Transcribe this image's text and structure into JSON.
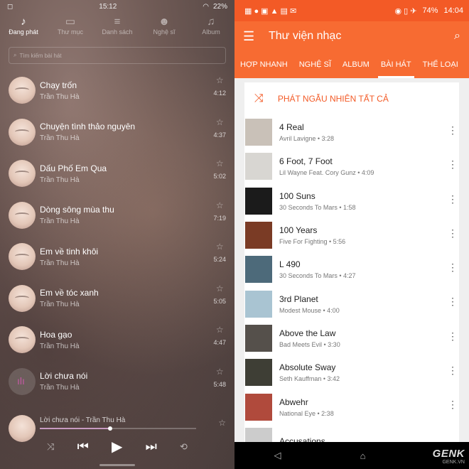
{
  "left": {
    "status": {
      "time": "15:12",
      "battery": "22%"
    },
    "tabs": [
      {
        "label": "Đang phát",
        "icon": "music-note-icon",
        "active": true
      },
      {
        "label": "Thư mục",
        "icon": "folder-icon",
        "active": false
      },
      {
        "label": "Danh sách",
        "icon": "playlist-icon",
        "active": false
      },
      {
        "label": "Nghệ sĩ",
        "icon": "artist-icon",
        "active": false
      },
      {
        "label": "Album",
        "icon": "album-icon",
        "active": false
      }
    ],
    "search_placeholder": "Tìm kiếm bài hát",
    "songs": [
      {
        "title": "Chạy trốn",
        "artist": "Trần Thu Hà",
        "duration": "4:12"
      },
      {
        "title": "Chuyện tình thảo nguyên",
        "artist": "Trần Thu Hà",
        "duration": "4:37"
      },
      {
        "title": "Dấu Phố Em Qua",
        "artist": "Trần Thu Hà",
        "duration": "5:02"
      },
      {
        "title": "Dòng sông mùa thu",
        "artist": "Trần Thu Hà",
        "duration": "7:19"
      },
      {
        "title": "Em về tinh khôi",
        "artist": "Trần Thu Hà",
        "duration": "5:24"
      },
      {
        "title": "Em về tóc xanh",
        "artist": "Trần Thu Hà",
        "duration": "5:05"
      },
      {
        "title": "Hoa gạo",
        "artist": "Trần Thu Hà",
        "duration": "4:47"
      },
      {
        "title": "Lời chưa nói",
        "artist": "Trần Thu Hà",
        "duration": "5:48",
        "playing": true
      }
    ],
    "now_playing": {
      "text": "Lời chưa nói - Trần Thu Hà",
      "progress": 0.45
    }
  },
  "right": {
    "status": {
      "battery": "74%",
      "time": "14:04"
    },
    "app_title": "Thư viện nhạc",
    "tabs": [
      "HỢP NHANH",
      "NGHỆ SĨ",
      "ALBUM",
      "BÀI HÁT",
      "THỂ LOẠI"
    ],
    "active_tab": "BÀI HÁT",
    "shuffle_label": "PHÁT NGẪU NHIÊN TẤT CẢ",
    "songs": [
      {
        "title": "4 Real",
        "subtitle": "Avril Lavigne • 3:28",
        "art": "#c9c1b8"
      },
      {
        "title": "6 Foot, 7 Foot",
        "subtitle": "Lil Wayne Feat. Cory Gunz • 4:09",
        "art": "#d8d6d2"
      },
      {
        "title": "100 Suns",
        "subtitle": "30 Seconds To Mars • 1:58",
        "art": "#1b1b1b"
      },
      {
        "title": "100 Years",
        "subtitle": "Five For Fighting • 5:56",
        "art": "#7a3b25"
      },
      {
        "title": "L 490",
        "subtitle": "30 Seconds To Mars • 4:27",
        "art": "#4d6a7a"
      },
      {
        "title": "3rd Planet",
        "subtitle": "Modest Mouse • 4:00",
        "art": "#a9c4d2"
      },
      {
        "title": "Above the Law",
        "subtitle": "Bad Meets Evil • 3:30",
        "art": "#55504b"
      },
      {
        "title": "Absolute Sway",
        "subtitle": "Seth Kauffman • 3:42",
        "art": "#3e3e35"
      },
      {
        "title": "Abwehr",
        "subtitle": "National Eye • 2:38",
        "art": "#b04a3c"
      },
      {
        "title": "Accusations",
        "subtitle": "",
        "art": "#cccccc"
      }
    ],
    "accent_color": "#f76b32",
    "watermark": {
      "brand": "GENK",
      "site": "GENK.VN"
    }
  }
}
